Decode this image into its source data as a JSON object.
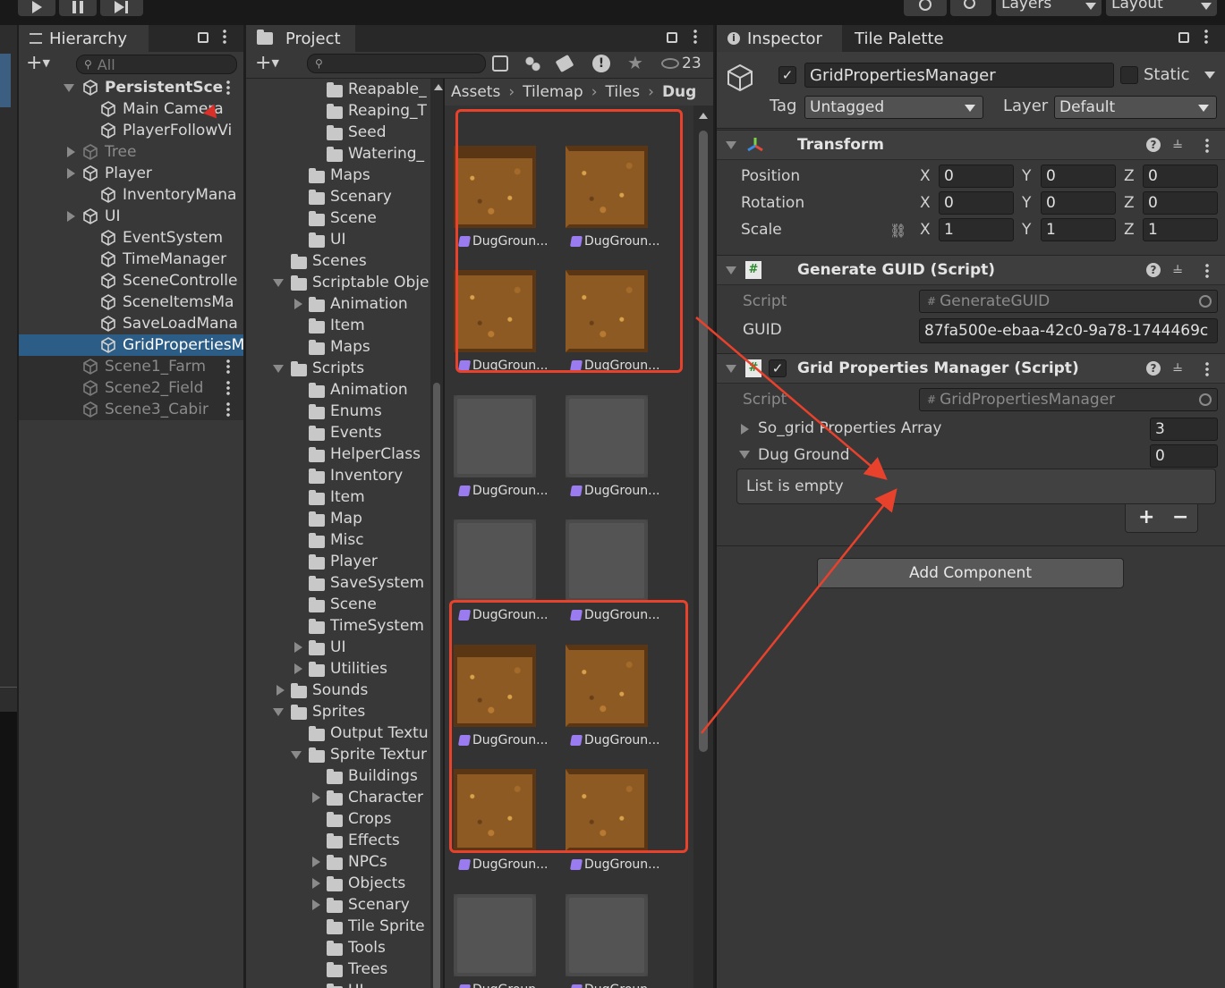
{
  "toolbar": {
    "layers_label": "Layers",
    "layout_label": "Layout"
  },
  "hierarchy": {
    "tab_label": "Hierarchy",
    "search_placeholder": "All",
    "items": [
      {
        "label": "PersistentSce",
        "bold": true
      },
      {
        "label": "Main Camera"
      },
      {
        "label": "PlayerFollowVi"
      },
      {
        "label": "Tree",
        "dim": true
      },
      {
        "label": "Player"
      },
      {
        "label": "InventoryMana"
      },
      {
        "label": "UI"
      },
      {
        "label": "EventSystem"
      },
      {
        "label": "TimeManager"
      },
      {
        "label": "SceneControlle"
      },
      {
        "label": "SceneItemsMa"
      },
      {
        "label": "SaveLoadMana"
      },
      {
        "label": "GridPropertiesM",
        "selected": true
      },
      {
        "label": "Scene1_Farm",
        "dim": true
      },
      {
        "label": "Scene2_Field",
        "dim": true
      },
      {
        "label": "Scene3_Cabir",
        "dim": true
      }
    ]
  },
  "project": {
    "tab_label": "Project",
    "hidden_count": "23",
    "breadcrumb": [
      "Assets",
      "Tilemap",
      "Tiles",
      "Dug"
    ],
    "tree": [
      "Reapable_",
      "Reaping_T",
      "Seed",
      "Watering_",
      "Maps",
      "Scenary",
      "Scene",
      "UI",
      "Scenes",
      "Scriptable Obje",
      "Animation",
      "Item",
      "Maps",
      "Scripts",
      "Animation",
      "Enums",
      "Events",
      "HelperClass",
      "Inventory",
      "Item",
      "Map",
      "Misc",
      "Player",
      "SaveSystem",
      "Scene",
      "TimeSystem",
      "UI",
      "Utilities",
      "Sounds",
      "Sprites",
      "Output Textu",
      "Sprite Textur",
      "Buildings",
      "Character",
      "Crops",
      "Effects",
      "NPCs",
      "Objects",
      "Scenary",
      "Tile Sprite",
      "Tools",
      "Trees",
      "UI"
    ],
    "tile_label": "DugGroun..."
  },
  "inspector": {
    "tab_label": "Inspector",
    "tab2_label": "Tile Palette",
    "object_name": "GridPropertiesManager",
    "static_label": "Static",
    "tag_label": "Tag",
    "tag_value": "Untagged",
    "layer_label": "Layer",
    "layer_value": "Default",
    "transform": {
      "title": "Transform",
      "position_label": "Position",
      "rotation_label": "Rotation",
      "scale_label": "Scale",
      "x": "X",
      "y": "Y",
      "z": "Z",
      "pos": [
        "0",
        "0",
        "0"
      ],
      "rot": [
        "0",
        "0",
        "0"
      ],
      "scale": [
        "1",
        "1",
        "1"
      ]
    },
    "guid_comp": {
      "title": "Generate GUID (Script)",
      "script_label": "Script",
      "script_value": "GenerateGUID",
      "guid_label": "GUID",
      "guid_value": "87fa500e-ebaa-42c0-9a78-1744469c"
    },
    "gpm_comp": {
      "title": "Grid Properties Manager (Script)",
      "script_label": "Script",
      "script_value": "GridPropertiesManager",
      "array_label": "So_grid Properties Array",
      "array_count": "3",
      "dug_label": "Dug Ground",
      "dug_count": "0",
      "empty_text": "List is empty"
    },
    "add_component_label": "Add Component"
  },
  "colors": {
    "selection": "#2c5d87",
    "annotation": "#e8412c",
    "panel": "#383838"
  }
}
